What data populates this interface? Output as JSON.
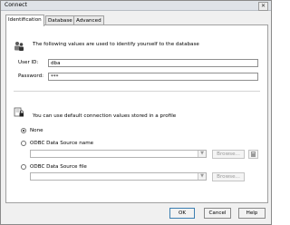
{
  "window": {
    "title": "Connect",
    "close_glyph": "✕"
  },
  "tabs": [
    {
      "label": "Identification"
    },
    {
      "label": "Database"
    },
    {
      "label": "Advanced"
    }
  ],
  "identification": {
    "intro": "The following values are used to identify yourself to the database",
    "user_id_label": "User ID:",
    "user_id_value": "dba",
    "password_label": "Password:",
    "password_value": "***"
  },
  "profile": {
    "intro": "You can use default connection values stored in a profile",
    "options": [
      {
        "label": "None",
        "selected": true
      },
      {
        "label": "ODBC Data Source name",
        "selected": false
      },
      {
        "label": "ODBC Data Source file",
        "selected": false
      }
    ],
    "browse_label": "Browse...",
    "dropdown_glyph": "▼"
  },
  "buttons": {
    "ok": "OK",
    "cancel": "Cancel",
    "help": "Help"
  },
  "icons": {
    "identification": "people-icon",
    "profile": "profile-lock-icon",
    "source_test": "server-icon"
  }
}
